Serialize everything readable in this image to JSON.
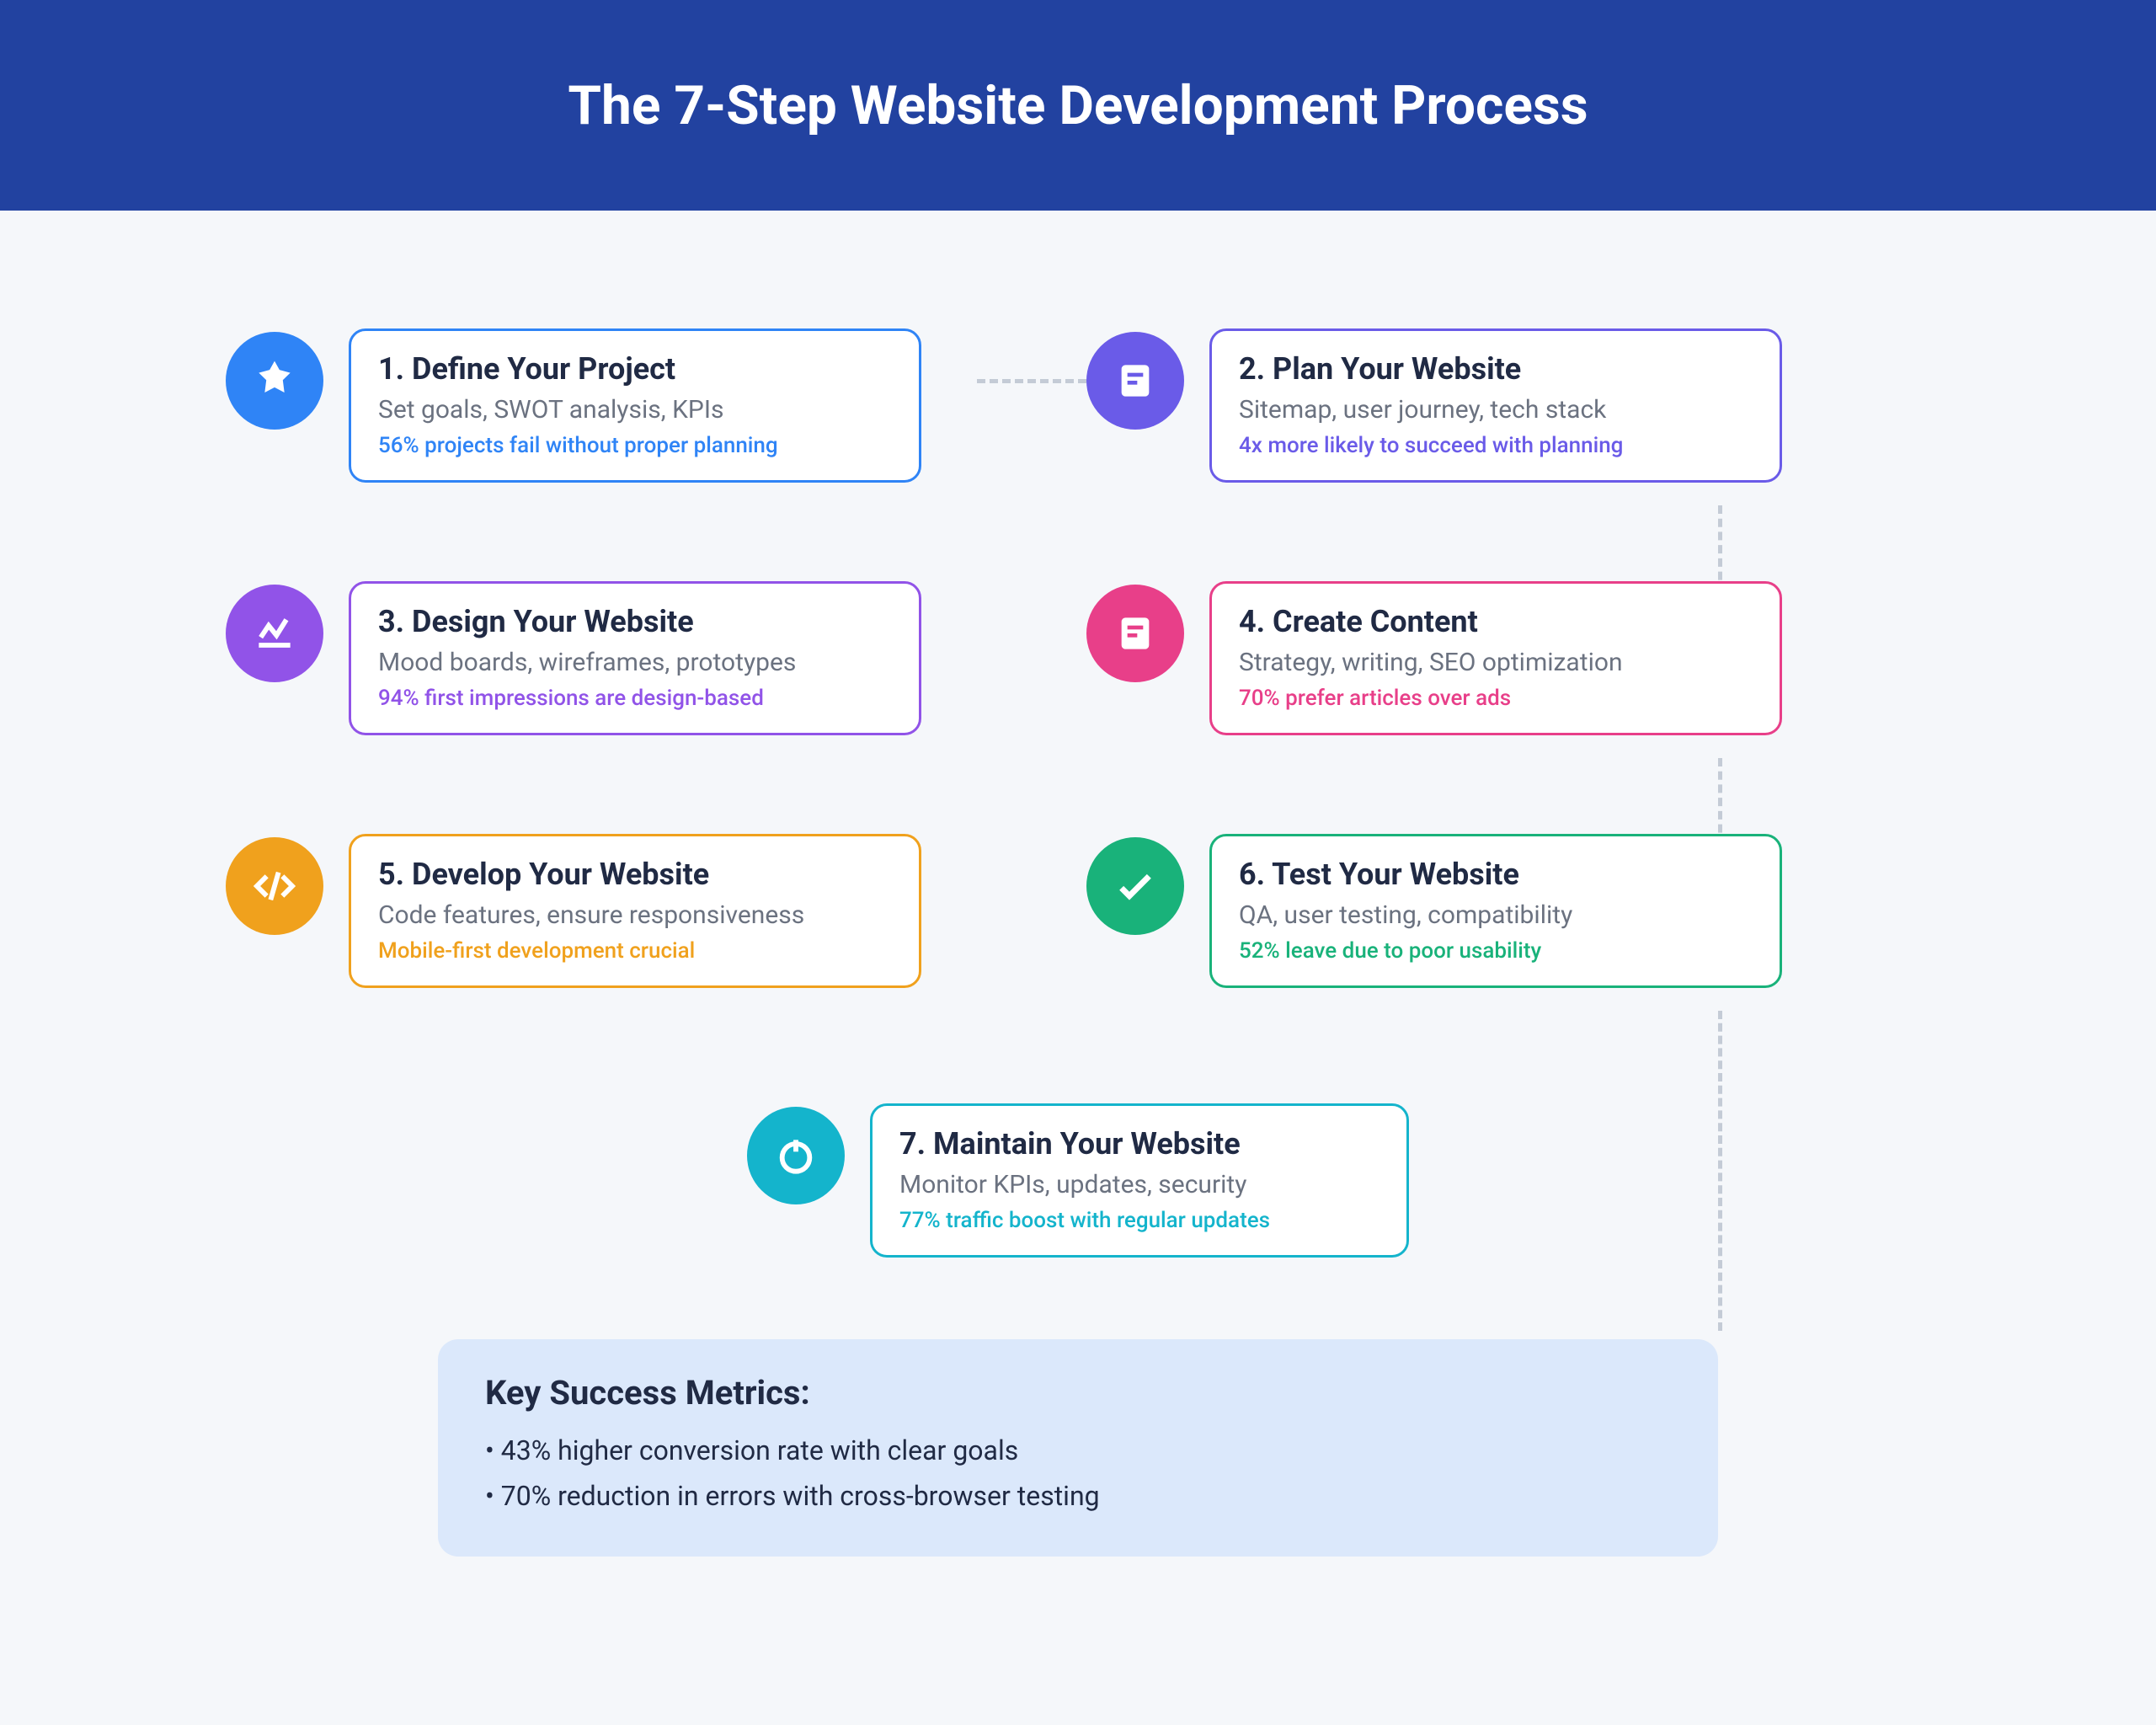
{
  "header": {
    "title": "The 7-Step Website Development Process"
  },
  "steps": {
    "s1": {
      "title": "1. Define Your Project",
      "sub": "Set goals, SWOT analysis, KPIs",
      "stat": "56% projects fail without proper planning",
      "color": "#2f84f6",
      "icon": "star-icon"
    },
    "s2": {
      "title": "2. Plan Your Website",
      "sub": "Sitemap, user journey, tech stack",
      "stat": "4x more likely to succeed with planning",
      "color": "#6a5be8",
      "icon": "document-icon"
    },
    "s3": {
      "title": "3. Design Your Website",
      "sub": "Mood boards, wireframes, prototypes",
      "stat": "94% first impressions are design-based",
      "color": "#9153e8",
      "icon": "chart-line-icon"
    },
    "s4": {
      "title": "4. Create Content",
      "sub": "Strategy, writing, SEO optimization",
      "stat": "70% prefer articles over ads",
      "color": "#e83f89",
      "icon": "document-icon"
    },
    "s5": {
      "title": "5. Develop Your Website",
      "sub": "Code features, ensure responsiveness",
      "stat": "Mobile-first development crucial",
      "color": "#f0a11d",
      "icon": "code-icon"
    },
    "s6": {
      "title": "6. Test Your Website",
      "sub": "QA, user testing, compatibility",
      "stat": "52% leave due to poor usability",
      "color": "#19b27a",
      "icon": "check-icon"
    },
    "s7": {
      "title": "7. Maintain Your Website",
      "sub": "Monitor KPIs, updates, security",
      "stat": "77% traffic boost with regular updates",
      "color": "#14b4cc",
      "icon": "power-icon"
    }
  },
  "metrics": {
    "title": "Key Success Metrics:",
    "items": [
      "• 43% higher conversion rate with clear goals",
      "• 70% reduction in errors with cross-browser testing"
    ]
  }
}
